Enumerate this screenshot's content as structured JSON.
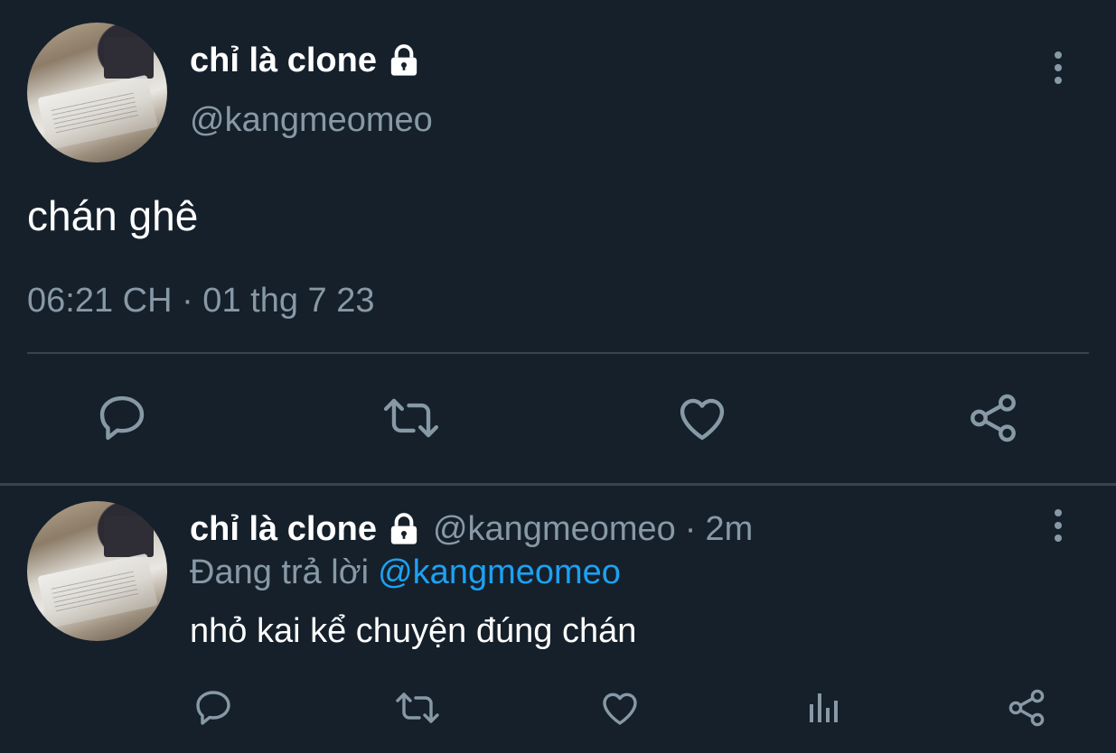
{
  "tweet": {
    "author_name": "chỉ là clone",
    "author_handle": "@kangmeomeo",
    "text": "chán ghê",
    "timestamp": "06:21 CH · 01 thg 7 23"
  },
  "reply": {
    "author_name": "chỉ là clone",
    "author_handle": "@kangmeomeo",
    "separator": "·",
    "age": "2m",
    "replying_to_label": "Đang trả lời",
    "replying_to_handle": "@kangmeomeo",
    "text": "nhỏ kai kể chuyện đúng chán"
  },
  "icons": {
    "lock": "lock-icon",
    "more": "more-vertical-icon",
    "reply": "reply-icon",
    "retweet": "retweet-icon",
    "like": "heart-icon",
    "share": "share-icon",
    "analytics": "analytics-icon"
  },
  "colors": {
    "background": "#15202b",
    "text": "#ffffff",
    "muted": "#8899a6",
    "accent": "#1da1f2",
    "divider": "#38444d"
  }
}
